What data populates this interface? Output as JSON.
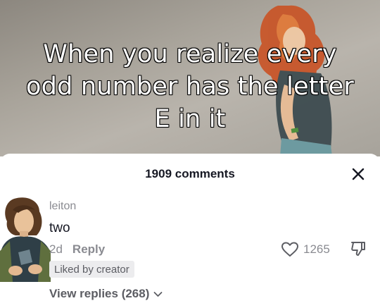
{
  "video": {
    "caption_lines": [
      "When you realize every",
      "odd number has the letter",
      "E in it"
    ]
  },
  "comments_sheet": {
    "title": "1909 comments",
    "close_icon": "close-icon"
  },
  "comment": {
    "username": "leiton",
    "text": "two",
    "age": "2d",
    "reply_label": "Reply",
    "liked_badge": "Liked by creator",
    "like_count": "1265",
    "like_icon": "heart-outline-icon",
    "dislike_icon": "thumbs-down-icon",
    "view_replies": "View replies (268)",
    "view_replies_icon": "chevron-down-icon"
  },
  "colors": {
    "text_primary": "#161823",
    "text_secondary": "#8a8b91",
    "badge_bg": "#ececee"
  }
}
